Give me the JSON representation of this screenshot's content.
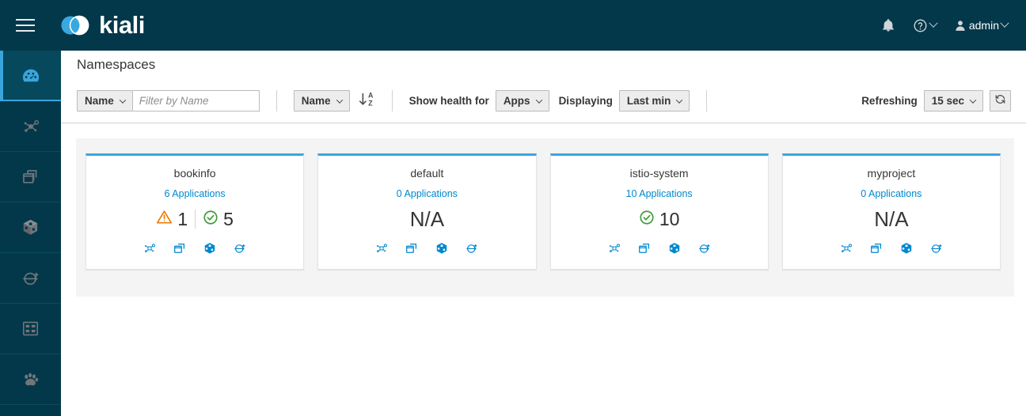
{
  "masthead": {
    "brand_name": "kiali",
    "hamburger_name": "global-navigation-toggle",
    "notifications_label": "Notifications",
    "help_label": "Help",
    "user_label": "admin"
  },
  "sidebar": {
    "items": [
      {
        "id": "overview",
        "label": "Overview",
        "icon": "dashboard-icon",
        "active": true
      },
      {
        "id": "graph",
        "label": "Graph",
        "icon": "topology-graph-icon",
        "active": false
      },
      {
        "id": "applications",
        "label": "Applications",
        "icon": "applications-icon",
        "active": false
      },
      {
        "id": "workloads",
        "label": "Workloads",
        "icon": "workloads-cube-icon",
        "active": false
      },
      {
        "id": "services",
        "label": "Services",
        "icon": "services-icon",
        "active": false
      },
      {
        "id": "istio-config",
        "label": "Istio Config",
        "icon": "istio-config-grid-icon",
        "active": false
      },
      {
        "id": "distributed-tracing",
        "label": "Distributed Tracing",
        "icon": "paw-tracing-icon",
        "active": false
      }
    ]
  },
  "page": {
    "title": "Namespaces"
  },
  "toolbar": {
    "filter_category": "Name",
    "filter_placeholder": "Filter by Name",
    "filter_value": "",
    "sort_field": "Name",
    "sort_direction_icon": "sort-ascending-alpha-icon",
    "health_for_label": "Show health for",
    "health_for_value": "Apps",
    "displaying_label": "Displaying",
    "displaying_value": "Last min",
    "refreshing_label": "Refreshing",
    "refreshing_value": "15 sec",
    "refresh_icon": "refresh-icon"
  },
  "colors": {
    "masthead_bg": "#03384a",
    "accent_blue": "#39a5dc",
    "link_blue": "#0088ce",
    "healthy_green": "#3f9c35",
    "warning_orange": "#ec7a08",
    "panel_bg": "#f4f4f4"
  },
  "namespaces": [
    {
      "name": "bookinfo",
      "applications_label": "6 Applications",
      "health_type": "counts",
      "health": [
        {
          "status": "warning",
          "icon": "warning-triangle-icon",
          "count": "1"
        },
        {
          "status": "healthy",
          "icon": "check-circle-icon",
          "count": "5"
        }
      ],
      "na_label": "",
      "actions": [
        {
          "id": "graph",
          "icon": "topology-graph-icon",
          "label": "Graph"
        },
        {
          "id": "applications",
          "icon": "applications-icon",
          "label": "Applications"
        },
        {
          "id": "workloads",
          "icon": "workloads-cube-icon",
          "label": "Workloads"
        },
        {
          "id": "services",
          "icon": "services-icon",
          "label": "Services"
        }
      ]
    },
    {
      "name": "default",
      "applications_label": "0 Applications",
      "health_type": "na",
      "health": [],
      "na_label": "N/A",
      "actions": [
        {
          "id": "graph",
          "icon": "topology-graph-icon",
          "label": "Graph"
        },
        {
          "id": "applications",
          "icon": "applications-icon",
          "label": "Applications"
        },
        {
          "id": "workloads",
          "icon": "workloads-cube-icon",
          "label": "Workloads"
        },
        {
          "id": "services",
          "icon": "services-icon",
          "label": "Services"
        }
      ]
    },
    {
      "name": "istio-system",
      "applications_label": "10 Applications",
      "health_type": "counts",
      "health": [
        {
          "status": "healthy",
          "icon": "check-circle-icon",
          "count": "10"
        }
      ],
      "na_label": "",
      "actions": [
        {
          "id": "graph",
          "icon": "topology-graph-icon",
          "label": "Graph"
        },
        {
          "id": "applications",
          "icon": "applications-icon",
          "label": "Applications"
        },
        {
          "id": "workloads",
          "icon": "workloads-cube-icon",
          "label": "Workloads"
        },
        {
          "id": "services",
          "icon": "services-icon",
          "label": "Services"
        }
      ]
    },
    {
      "name": "myproject",
      "applications_label": "0 Applications",
      "health_type": "na",
      "health": [],
      "na_label": "N/A",
      "actions": [
        {
          "id": "graph",
          "icon": "topology-graph-icon",
          "label": "Graph"
        },
        {
          "id": "applications",
          "icon": "applications-icon",
          "label": "Applications"
        },
        {
          "id": "workloads",
          "icon": "workloads-cube-icon",
          "label": "Workloads"
        },
        {
          "id": "services",
          "icon": "services-icon",
          "label": "Services"
        }
      ]
    }
  ]
}
